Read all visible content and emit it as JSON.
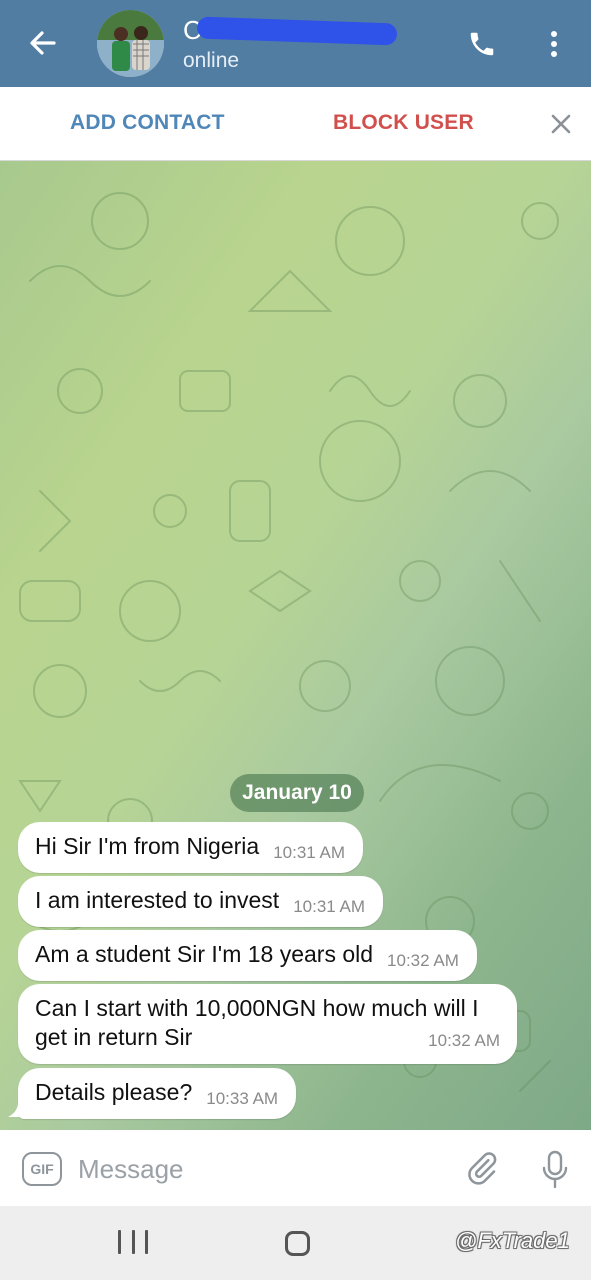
{
  "header": {
    "title": "C",
    "status": "online",
    "back_icon": "arrow-left-icon",
    "call_icon": "phone-icon",
    "menu_icon": "more-vertical-icon",
    "background_color": "#527da3"
  },
  "action_bar": {
    "add_contact_label": "ADD CONTACT",
    "block_user_label": "BLOCK USER",
    "close_icon": "close-icon",
    "add_contact_color": "#4f87b8",
    "block_user_color": "#d1504d"
  },
  "chat": {
    "date_separator": "January 10",
    "messages": [
      {
        "text": "Hi Sir I'm from Nigeria",
        "time": "10:31 AM"
      },
      {
        "text": "I am interested to invest",
        "time": "10:31 AM"
      },
      {
        "text": "Am a student Sir I'm 18 years old",
        "time": "10:32 AM"
      },
      {
        "text": "Can I start with 10,000NGN how much will I get in return Sir",
        "time": "10:32 AM"
      },
      {
        "text": "Details please?",
        "time": "10:33 AM"
      }
    ]
  },
  "composer": {
    "gif_label": "GIF",
    "placeholder": "Message",
    "attach_icon": "paperclip-icon",
    "mic_icon": "microphone-icon"
  },
  "navbar": {
    "recents_icon": "recents-icon",
    "home_icon": "home-icon",
    "watermark": "@FxTrade1"
  }
}
